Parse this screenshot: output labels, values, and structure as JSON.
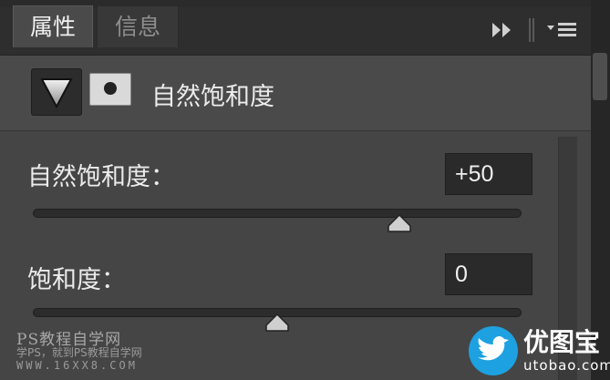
{
  "tabs": [
    {
      "label": "属性",
      "active": true
    },
    {
      "label": "信息",
      "active": false
    }
  ],
  "panel": {
    "title": "自然饱和度",
    "adjustment_icon": "triangle-down-icon",
    "mask_icon": "layer-mask-icon"
  },
  "controls": {
    "vibrance": {
      "label": "自然饱和度：",
      "value": "+50",
      "slider_fraction": 0.75
    },
    "saturation": {
      "label": "饱和度：",
      "value": "0",
      "slider_fraction": 0.5
    }
  },
  "watermark_left": {
    "line1": "PS教程自学网",
    "line2": "学PS，就到PS教程自学网",
    "line3": "WWW.16XX8.COM"
  },
  "watermark_right": {
    "brand": "优图宝",
    "domain": "utobao.com"
  },
  "colors": {
    "panel_bg": "#454545",
    "header_bg": "#4a4a4a",
    "field_bg": "#2a2a2a",
    "logo_blue": "#1da1e0"
  }
}
